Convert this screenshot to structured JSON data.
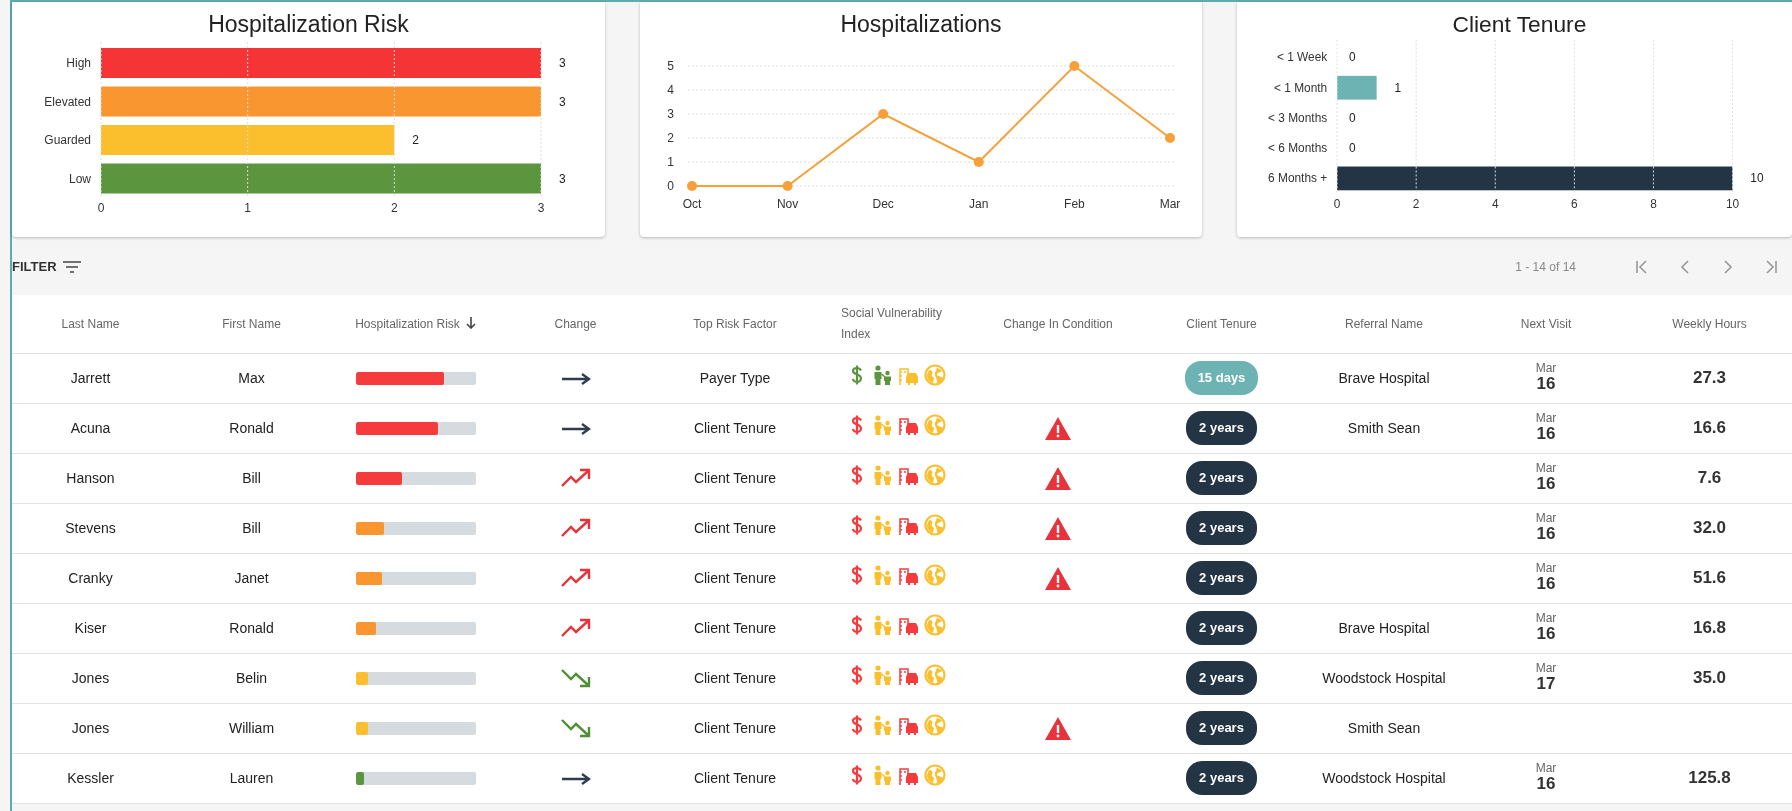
{
  "charts": [
    {
      "chart_data": {
        "type": "bar",
        "orientation": "horizontal",
        "title": "Hospitalization Risk",
        "categories": [
          "High",
          "Elevated",
          "Guarded",
          "Low"
        ],
        "values": [
          3,
          3,
          2,
          3
        ],
        "colors": [
          "#f53535",
          "#f9962f",
          "#fbbf2e",
          "#5b963f"
        ],
        "xlim": [
          0,
          3
        ],
        "xticks": [
          0,
          1,
          2,
          3
        ],
        "grid": true,
        "data_labels": true
      }
    },
    {
      "chart_data": {
        "type": "line",
        "title": "Hospitalizations",
        "categories": [
          "Oct",
          "Nov",
          "Dec",
          "Jan",
          "Feb",
          "Mar"
        ],
        "series": [
          {
            "color": "#f7a03a",
            "marker": "circle",
            "values": [
              0,
              0,
              3,
              1,
              5,
              2
            ]
          }
        ],
        "ylim": [
          0,
          5
        ],
        "yticks": [
          0,
          1,
          2,
          3,
          4,
          5
        ],
        "grid": true
      }
    },
    {
      "chart_data": {
        "type": "bar",
        "orientation": "horizontal",
        "title": "Client Tenure",
        "categories": [
          "< 1 Week",
          "< 1 Month",
          "< 3 Months",
          "< 6 Months",
          "6 Months +"
        ],
        "values": [
          0,
          1,
          0,
          0,
          10
        ],
        "colors": [
          null,
          "#6db3b3",
          null,
          null,
          "#233444"
        ],
        "xlim": [
          0,
          10
        ],
        "xticks": [
          0,
          2,
          4,
          6,
          8,
          10
        ],
        "grid": true,
        "data_labels": true
      }
    }
  ],
  "filter": {
    "label": "FILTER"
  },
  "pagination": {
    "range": "1 - 14 of 14"
  },
  "table": {
    "columns": [
      {
        "label": "Last Name"
      },
      {
        "label": "First Name"
      },
      {
        "label": "Hospitalization Risk",
        "sorted": true
      },
      {
        "label": "Change"
      },
      {
        "label": "Top Risk Factor"
      },
      {
        "label": "Social Vulnerability Index"
      },
      {
        "label": "Change In Condition"
      },
      {
        "label": "Client Tenure"
      },
      {
        "label": "Referral Name"
      },
      {
        "label": "Next Visit"
      },
      {
        "label": "Weekly Hours"
      }
    ],
    "rows": [
      {
        "last": "Jarrett",
        "first": "Max",
        "risk": {
          "level": 0.74,
          "color": "#f53b3b"
        },
        "change": {
          "kind": "flat"
        },
        "factor": "Payer Type",
        "svi": [
          {
            "kind": "dollar",
            "color": "#5b963f"
          },
          {
            "kind": "family",
            "color": "#5b963f"
          },
          {
            "kind": "transit",
            "color": "#fbbf2e"
          },
          {
            "kind": "globe",
            "color": "#fbbf2e"
          }
        ],
        "alert": false,
        "tenure": {
          "text": "15 days",
          "color": "#6db3b3"
        },
        "referral": "Brave Hospital",
        "visit": {
          "month": "Mar",
          "day": "16"
        },
        "hours": "27.3"
      },
      {
        "last": "Acuna",
        "first": "Ronald",
        "risk": {
          "level": 0.69,
          "color": "#f53b3b"
        },
        "change": {
          "kind": "flat"
        },
        "factor": "Client Tenure",
        "svi": [
          {
            "kind": "dollar",
            "color": "#f53b3b"
          },
          {
            "kind": "family",
            "color": "#fbbf2e"
          },
          {
            "kind": "transit",
            "color": "#f53b3b"
          },
          {
            "kind": "globe",
            "color": "#fbbf2e"
          }
        ],
        "alert": true,
        "tenure": {
          "text": "2 years",
          "color": "#233444"
        },
        "referral": "Smith Sean",
        "visit": {
          "month": "Mar",
          "day": "16"
        },
        "hours": "16.6"
      },
      {
        "last": "Hanson",
        "first": "Bill",
        "risk": {
          "level": 0.39,
          "color": "#f53b3b"
        },
        "change": {
          "kind": "up"
        },
        "factor": "Client Tenure",
        "svi": [
          {
            "kind": "dollar",
            "color": "#f53b3b"
          },
          {
            "kind": "family",
            "color": "#fbbf2e"
          },
          {
            "kind": "transit",
            "color": "#f53b3b"
          },
          {
            "kind": "globe",
            "color": "#fbbf2e"
          }
        ],
        "alert": true,
        "tenure": {
          "text": "2 years",
          "color": "#233444"
        },
        "visit": {
          "month": "Mar",
          "day": "16"
        },
        "hours": "7.6"
      },
      {
        "last": "Stevens",
        "first": "Bill",
        "risk": {
          "level": 0.24,
          "color": "#f9962f"
        },
        "change": {
          "kind": "up"
        },
        "factor": "Client Tenure",
        "svi": [
          {
            "kind": "dollar",
            "color": "#f53b3b"
          },
          {
            "kind": "family",
            "color": "#fbbf2e"
          },
          {
            "kind": "transit",
            "color": "#f53b3b"
          },
          {
            "kind": "globe",
            "color": "#fbbf2e"
          }
        ],
        "alert": true,
        "tenure": {
          "text": "2 years",
          "color": "#233444"
        },
        "visit": {
          "month": "Mar",
          "day": "16"
        },
        "hours": "32.0"
      },
      {
        "last": "Cranky",
        "first": "Janet",
        "risk": {
          "level": 0.22,
          "color": "#f9962f"
        },
        "change": {
          "kind": "up"
        },
        "factor": "Client Tenure",
        "svi": [
          {
            "kind": "dollar",
            "color": "#f53b3b"
          },
          {
            "kind": "family",
            "color": "#fbbf2e"
          },
          {
            "kind": "transit",
            "color": "#f53b3b"
          },
          {
            "kind": "globe",
            "color": "#fbbf2e"
          }
        ],
        "alert": true,
        "tenure": {
          "text": "2 years",
          "color": "#233444"
        },
        "visit": {
          "month": "Mar",
          "day": "16"
        },
        "hours": "51.6"
      },
      {
        "last": "Kiser",
        "first": "Ronald",
        "risk": {
          "level": 0.17,
          "color": "#f9962f"
        },
        "change": {
          "kind": "up"
        },
        "factor": "Client Tenure",
        "svi": [
          {
            "kind": "dollar",
            "color": "#f53b3b"
          },
          {
            "kind": "family",
            "color": "#fbbf2e"
          },
          {
            "kind": "transit",
            "color": "#f53b3b"
          },
          {
            "kind": "globe",
            "color": "#fbbf2e"
          }
        ],
        "alert": false,
        "tenure": {
          "text": "2 years",
          "color": "#233444"
        },
        "referral": "Brave Hospital",
        "visit": {
          "month": "Mar",
          "day": "16"
        },
        "hours": "16.8"
      },
      {
        "last": "Jones",
        "first": "Belin",
        "risk": {
          "level": 0.1,
          "color": "#fbbf2e"
        },
        "change": {
          "kind": "down"
        },
        "factor": "Client Tenure",
        "svi": [
          {
            "kind": "dollar",
            "color": "#f53b3b"
          },
          {
            "kind": "family",
            "color": "#fbbf2e"
          },
          {
            "kind": "transit",
            "color": "#f53b3b"
          },
          {
            "kind": "globe",
            "color": "#fbbf2e"
          }
        ],
        "alert": false,
        "tenure": {
          "text": "2 years",
          "color": "#233444"
        },
        "referral": "Woodstock Hospital",
        "visit": {
          "month": "Mar",
          "day": "17"
        },
        "hours": "35.0"
      },
      {
        "last": "Jones",
        "first": "William",
        "risk": {
          "level": 0.1,
          "color": "#fbbf2e"
        },
        "change": {
          "kind": "down"
        },
        "factor": "Client Tenure",
        "svi": [
          {
            "kind": "dollar",
            "color": "#f53b3b"
          },
          {
            "kind": "family",
            "color": "#fbbf2e"
          },
          {
            "kind": "transit",
            "color": "#f53b3b"
          },
          {
            "kind": "globe",
            "color": "#fbbf2e"
          }
        ],
        "alert": true,
        "tenure": {
          "text": "2 years",
          "color": "#233444"
        },
        "referral": "Smith Sean"
      },
      {
        "last": "Kessler",
        "first": "Lauren",
        "risk": {
          "level": 0.07,
          "color": "#5b963f"
        },
        "change": {
          "kind": "flat"
        },
        "factor": "Client Tenure",
        "svi": [
          {
            "kind": "dollar",
            "color": "#f53b3b"
          },
          {
            "kind": "family",
            "color": "#fbbf2e"
          },
          {
            "kind": "transit",
            "color": "#f53b3b"
          },
          {
            "kind": "globe",
            "color": "#fbbf2e"
          }
        ],
        "alert": false,
        "tenure": {
          "text": "2 years",
          "color": "#233444"
        },
        "referral": "Woodstock Hospital",
        "visit": {
          "month": "Mar",
          "day": "16"
        },
        "hours": "125.8"
      }
    ]
  }
}
